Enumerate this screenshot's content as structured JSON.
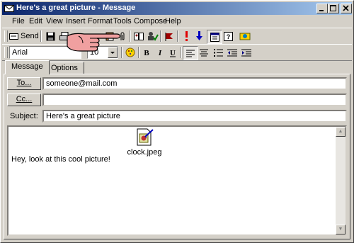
{
  "window": {
    "title": "Here's a great picture - Message"
  },
  "menu": [
    {
      "label": "File"
    },
    {
      "label": "Edit"
    },
    {
      "label": "View"
    },
    {
      "label": "Insert"
    },
    {
      "label": "Format"
    },
    {
      "label": "Tools"
    },
    {
      "label": "Compose"
    },
    {
      "label": "Help"
    }
  ],
  "toolbar": {
    "send_label": "Send",
    "icons": [
      "save-icon",
      "print-icon",
      "cut-icon",
      "copy-icon",
      "paste-icon",
      "attach-icon",
      "address-book-icon",
      "check-names-icon",
      "flag-icon",
      "importance-high-icon",
      "importance-low-icon",
      "properties-icon",
      "help-icon",
      "options-icon"
    ]
  },
  "format": {
    "font": "Arial",
    "size": "10",
    "icons": [
      "font-color-icon",
      "bold-icon",
      "italic-icon",
      "underline-icon",
      "align-left-icon",
      "center-icon",
      "bullets-icon",
      "decrease-indent-icon",
      "increase-indent-icon"
    ]
  },
  "tabs": [
    {
      "label": "Message"
    },
    {
      "label": "Options"
    }
  ],
  "fields": {
    "to_label": "To...",
    "to_value": "someone@mail.com",
    "cc_label": "Cc...",
    "cc_value": "",
    "subject_label": "Subject:",
    "subject_value": "Here's a great picture"
  },
  "message": {
    "attachment_name": "clock.jpeg",
    "body_text": "Hey, look at this cool picture!"
  },
  "colors": {
    "title_start": "#0a246a",
    "title_end": "#a6caf0",
    "hand": "#f0a0a0",
    "flag": "#a00000",
    "important": "#e00000",
    "low": "#0000c0"
  }
}
